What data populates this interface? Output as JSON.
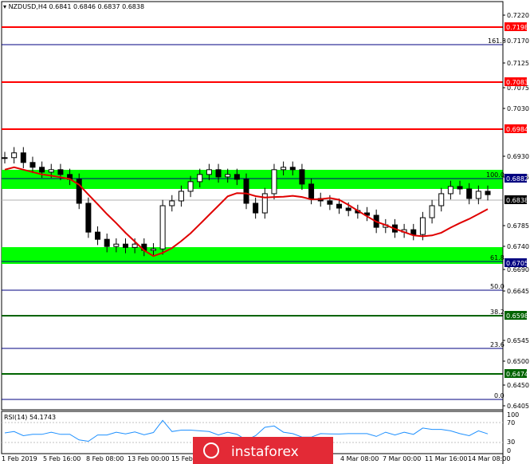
{
  "header": {
    "symbol_line": "NZDUSD,H4  0.6841 0.6846 0.6837 0.6838"
  },
  "price_axis": [
    {
      "label": "0.7220"
    },
    {
      "label": "0.7170"
    },
    {
      "label": "0.7125"
    },
    {
      "label": "0.7075"
    },
    {
      "label": "0.7030"
    },
    {
      "label": "0.6930"
    },
    {
      "label": "0.6885"
    },
    {
      "label": "0.6785"
    },
    {
      "label": "0.6740"
    },
    {
      "label": "0.6690"
    },
    {
      "label": "0.6645"
    },
    {
      "label": "0.6545"
    },
    {
      "label": "0.6500"
    },
    {
      "label": "0.6450"
    },
    {
      "label": "0.6405"
    }
  ],
  "levels": {
    "res3": "0.7198",
    "res2": "0.7083",
    "res1": "0.6984",
    "pivot": "0.6882",
    "current": "0.6838",
    "sup1": "0.6705",
    "sup2": "0.6598",
    "sup3": "0.6474"
  },
  "fib": {
    "f1618": "161.8",
    "f100": "100.0",
    "f618": "61.8",
    "f50": "50.0",
    "f382": "38.2",
    "f236": "23.6",
    "f0": "0.0"
  },
  "rsi": {
    "label": "RSI(14) 54.1743",
    "t100": "100",
    "t70": "70",
    "t30": "30",
    "t0": "0"
  },
  "time_axis": [
    {
      "label": "1 Feb 2019"
    },
    {
      "label": "5 Feb 16:00"
    },
    {
      "label": "8 Feb 08:00"
    },
    {
      "label": "13 Feb 00:00"
    },
    {
      "label": "15 Feb"
    },
    {
      "label": "4 Mar 08:00"
    },
    {
      "label": "7 Mar 00:00"
    },
    {
      "label": "11 Mar 16:00"
    },
    {
      "label": "14 Mar 08:00"
    }
  ],
  "watermark": {
    "text": "instaforex"
  },
  "colors": {
    "support_zone": "#00ff00",
    "resistance": "#ff0000",
    "fib_blue": "#000080",
    "fib_green": "#006400",
    "ma": "#e00000",
    "rsi": "#1e90ff"
  },
  "chart_data": {
    "type": "candlestick",
    "symbol": "NZDUSD",
    "timeframe": "H4",
    "ohlc_last": [
      0.6841,
      0.6846,
      0.6837,
      0.6838
    ],
    "y_range": [
      0.639,
      0.724
    ],
    "close_series_approx": [
      0.6915,
      0.6925,
      0.6905,
      0.6895,
      0.6885,
      0.689,
      0.688,
      0.687,
      0.682,
      0.676,
      0.6745,
      0.673,
      0.6735,
      0.6728,
      0.6735,
      0.6722,
      0.6725,
      0.6815,
      0.6825,
      0.6845,
      0.6865,
      0.688,
      0.689,
      0.6875,
      0.688,
      0.687,
      0.682,
      0.68,
      0.684,
      0.689,
      0.6895,
      0.689,
      0.686,
      0.683,
      0.6825,
      0.6818,
      0.681,
      0.6805,
      0.68,
      0.6795,
      0.677,
      0.6775,
      0.676,
      0.6765,
      0.6755,
      0.679,
      0.6815,
      0.684,
      0.6855,
      0.685,
      0.683,
      0.6845,
      0.6838
    ]
  }
}
